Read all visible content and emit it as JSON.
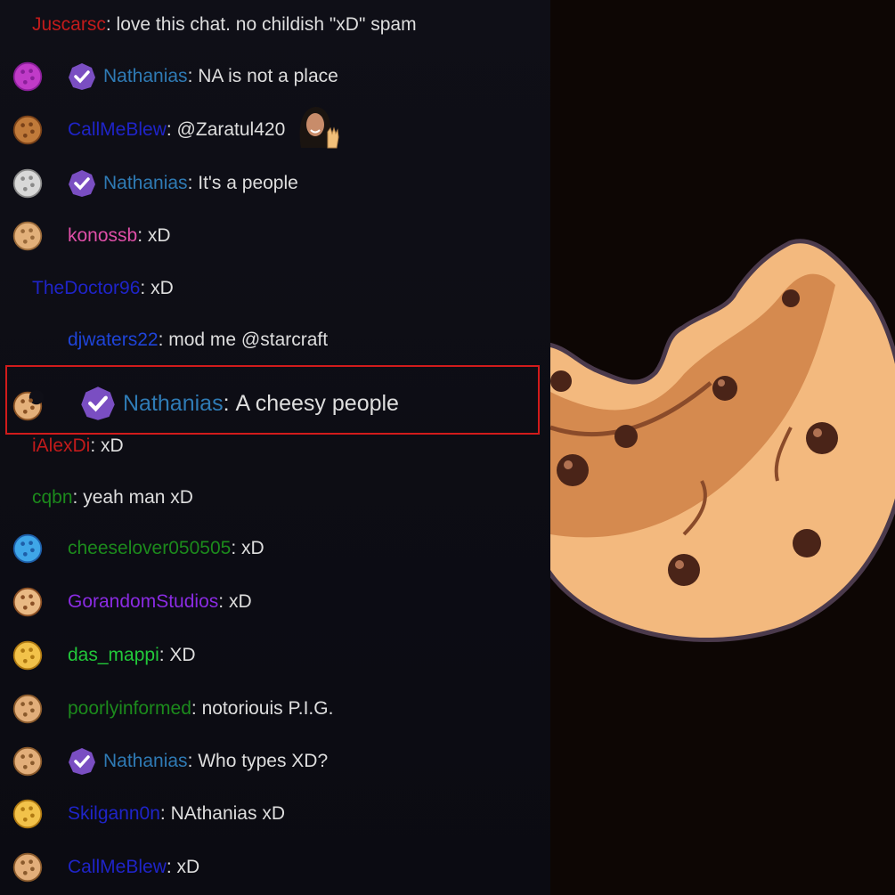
{
  "colors": {
    "chat_background": "#0f0f17",
    "stream_background": "#0d0604",
    "highlight_border": "#d11b1b",
    "message_text": "#dedede",
    "badge_purple": "#7a4ec2"
  },
  "messages": [
    {
      "user": "Juscarsc",
      "text": "love this chat. no childish \"xD\" spam",
      "user_color": "#c21b1b",
      "icon": "",
      "verified": false
    },
    {
      "user": "Nathanias",
      "text": "NA is not a place",
      "user_color": "#2f7bb5",
      "icon": "purple-cookie-icon",
      "verified": true
    },
    {
      "user": "CallMeBlew",
      "text": "@Zaratul420",
      "user_color": "#1f24c8",
      "icon": "brown-cookie-icon",
      "verified": false,
      "emote": "waving-woman-emote"
    },
    {
      "user": "Nathanias",
      "text": "It's a people",
      "user_color": "#2f7bb5",
      "icon": "silver-cookie-icon",
      "verified": true
    },
    {
      "user": "konossb",
      "text": "xD",
      "user_color": "#e04fa8",
      "icon": "crumbly-cookie-icon",
      "verified": false
    },
    {
      "user": "TheDoctor96",
      "text": "xD",
      "user_color": "#1f24c8",
      "icon": "",
      "verified": false
    },
    {
      "user": "djwaters22",
      "text": "mod me @starcraft",
      "user_color": "#1f44d8",
      "icon": "",
      "verified": false
    },
    {
      "user": "Nathanias",
      "text": "A cheesy people",
      "user_color": "#2f7bb5",
      "icon": "bitten-cookie-icon",
      "verified": true,
      "highlighted": true
    },
    {
      "user": "iAlexDi",
      "text": "xD",
      "user_color": "#c21b1b",
      "icon": "",
      "verified": false
    },
    {
      "user": "cqbn",
      "text": "yeah man xD",
      "user_color": "#1c8a1c",
      "icon": "",
      "verified": false
    },
    {
      "user": "cheeselover050505",
      "text": "xD",
      "user_color": "#1c8a1c",
      "icon": "blue-cookie-icon",
      "verified": false
    },
    {
      "user": "GorandomStudios",
      "text": "xD",
      "user_color": "#8a2be2",
      "icon": "chocolate-chip-cookie-icon",
      "verified": false
    },
    {
      "user": "das_mappi",
      "text": "XD",
      "user_color": "#22c83a",
      "icon": "golden-cookie-icon",
      "verified": false
    },
    {
      "user": "poorlyinformed",
      "text": "notoriouis P.I.G.",
      "user_color": "#1c8a1c",
      "icon": "stacked-cookie-icon",
      "verified": false
    },
    {
      "user": "Nathanias",
      "text": "Who types XD?",
      "user_color": "#2f7bb5",
      "icon": "stacked-cookie-icon",
      "verified": true
    },
    {
      "user": "Skilgann0n",
      "text": "NAthanias xD",
      "user_color": "#1f24c8",
      "icon": "golden-cookie-icon",
      "verified": false
    },
    {
      "user": "CallMeBlew",
      "text": "xD",
      "user_color": "#1f24c8",
      "icon": "stacked-cookie-icon",
      "verified": false
    }
  ],
  "stream": {
    "overlay": "giant-bitten-cookie-icon"
  }
}
